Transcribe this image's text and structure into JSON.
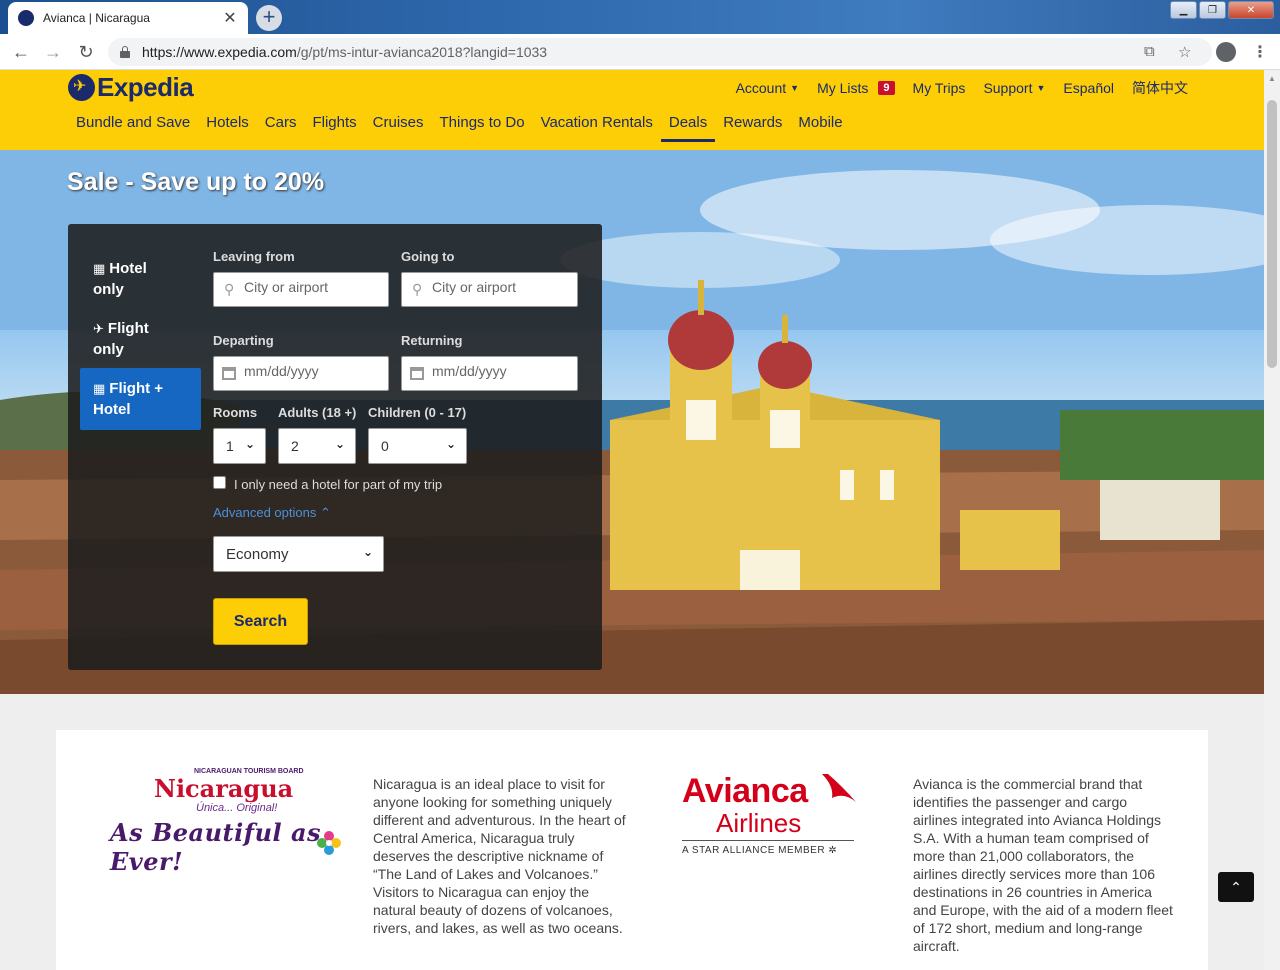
{
  "browser": {
    "tab_title": "Avianca | Nicaragua",
    "tab_close": "✕",
    "new_tab": "+",
    "url_host": "https://www.expedia.com",
    "url_path": "/g/pt/ms-intur-avianca2018?langid=1033",
    "window_controls": [
      "▁",
      "❐",
      "✕"
    ],
    "icons": [
      "back-icon",
      "forward-icon",
      "reload-icon",
      "lock-icon",
      "translate-icon",
      "star-icon",
      "profile-icon",
      "menu-icon"
    ]
  },
  "header": {
    "logo_text": "Expedia",
    "utility": {
      "account": "Account",
      "my_lists": "My Lists",
      "lists_badge": "9",
      "my_trips": "My Trips",
      "support": "Support",
      "espanol": "Español",
      "chinese": "简体中文"
    },
    "nav": [
      "Bundle and Save",
      "Hotels",
      "Cars",
      "Flights",
      "Cruises",
      "Things to Do",
      "Vacation Rentals",
      "Deals",
      "Rewards",
      "Mobile"
    ],
    "active_nav": "Deals",
    "colors": {
      "brand_yellow": "#fdcd06",
      "brand_navy": "#1b2a6b",
      "badge_red": "#c8102e"
    }
  },
  "hero": {
    "title": "Sale - Save up to 20%"
  },
  "search": {
    "tabs": [
      {
        "label1": "Hotel",
        "label2": "only",
        "icon": "hotel-icon"
      },
      {
        "label1": "Flight",
        "label2": "only",
        "icon": "plane-icon"
      },
      {
        "label1": "Flight +",
        "label2": "Hotel",
        "icon": "hotel-plane-icon"
      }
    ],
    "active_tab": "Flight + Hotel",
    "leaving_from": {
      "label": "Leaving from",
      "placeholder": "City or airport"
    },
    "going_to": {
      "label": "Going to",
      "placeholder": "City or airport"
    },
    "departing": {
      "label": "Departing",
      "placeholder": "mm/dd/yyyy"
    },
    "returning": {
      "label": "Returning",
      "placeholder": "mm/dd/yyyy"
    },
    "rooms": {
      "label": "Rooms",
      "value": "1"
    },
    "adults": {
      "label": "Adults (18 +)",
      "value": "2"
    },
    "children": {
      "label": "Children (0 - 17)",
      "value": "0"
    },
    "partial_hotel": "I only need a hotel for part of my trip",
    "advanced": "Advanced options",
    "cabin_class": "Economy",
    "search_button": "Search",
    "colors": {
      "active_tab": "#1667c1",
      "link": "#4f8fd9"
    }
  },
  "content": {
    "nicaragua": {
      "small": "NICARAGUAN TOURISM BOARD",
      "name": "Nicaragua",
      "tag": "Única... Original!",
      "slogan": "As Beautiful as Ever!",
      "description": "Nicaragua is an ideal place to visit for anyone looking for something uniquely different and adventurous. In the heart of Central America, Nicaragua truly deserves the descriptive nickname of “The Land of Lakes and Volcanoes.” Visitors to Nicaragua can enjoy the natural beauty of dozens of volcanoes, rivers, and lakes, as well as two oceans."
    },
    "avianca": {
      "name": "Avianca",
      "airlines": "Airlines",
      "star_alliance": "A STAR ALLIANCE MEMBER ✲",
      "description": "Avianca is the commercial brand that identifies the passenger and cargo airlines integrated into Avianca Holdings S.A. With a human team comprised of more than 21,000 collaborators, the airlines directly services more than 106 destinations in 26 countries in America and Europe, with the aid of a modern fleet of 172 short, medium and long-range aircraft."
    }
  },
  "back_to_top": "⌃"
}
